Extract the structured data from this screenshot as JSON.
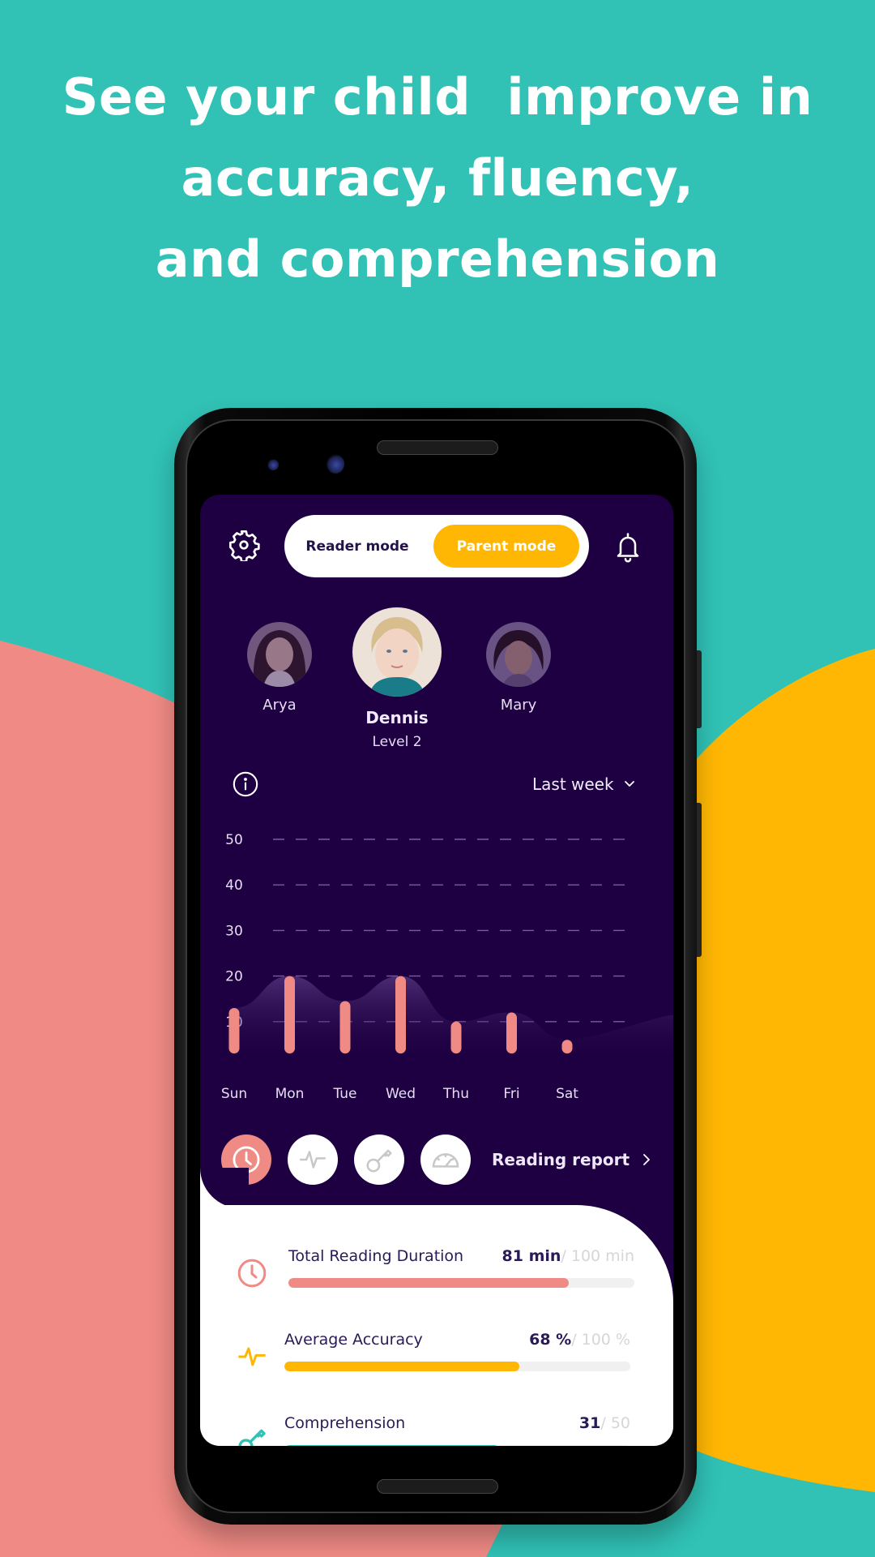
{
  "headline": {
    "lines": [
      "See your child  improve in",
      "accuracy, fluency,",
      "and comprehension"
    ]
  },
  "colors": {
    "teal": "#31C1B5",
    "coral": "#F08A84",
    "yellow": "#FFB703",
    "app_bg": "#1E0042"
  },
  "app": {
    "top_bar": {
      "settings_icon": "gear-icon",
      "modes": [
        {
          "label": "Reader mode",
          "selected": false
        },
        {
          "label": "Parent mode",
          "selected": true
        }
      ],
      "notifications_icon": "bell-icon"
    },
    "profiles": [
      {
        "name": "Arya",
        "selected": false
      },
      {
        "name": "Dennis",
        "level": "Level 2",
        "selected": true
      },
      {
        "name": "Mary",
        "selected": false
      }
    ],
    "info_icon": "info-icon",
    "period": {
      "selected": "Last week",
      "icon": "chevron-down-icon"
    },
    "metric_tabs": [
      {
        "icon": "clock-icon",
        "selected": true
      },
      {
        "icon": "pulse-icon",
        "selected": false
      },
      {
        "icon": "key-icon",
        "selected": false
      },
      {
        "icon": "speedometer-icon",
        "selected": false
      }
    ],
    "report_link": {
      "label": "Reading report",
      "icon": "chevron-right-icon"
    },
    "stats": [
      {
        "label": "Total Reading Duration",
        "value": "81 min",
        "max": "/ 100 min",
        "progress": 0.81,
        "icon": "clock-icon",
        "color": "#F08A84"
      },
      {
        "label": "Average Accuracy",
        "value": "68 %",
        "max": "/ 100 %",
        "progress": 0.68,
        "icon": "pulse-icon",
        "color": "#FFB703"
      },
      {
        "label": "Comprehension",
        "value": "31",
        "max": "/ 50",
        "progress": 0.62,
        "icon": "key-icon",
        "color": "#31C1B5"
      }
    ]
  },
  "chart_data": {
    "type": "bar",
    "title": "",
    "xlabel": "",
    "ylabel": "",
    "categories": [
      "Sun",
      "Mon",
      "Tue",
      "Wed",
      "Thu",
      "Fri",
      "Sat"
    ],
    "values": [
      13,
      20,
      14.5,
      20,
      10,
      12,
      6
    ],
    "baseline": 3,
    "ylim": [
      0,
      50
    ],
    "yticks": [
      10,
      20,
      30,
      40,
      50
    ],
    "grid": true,
    "grid_style": "dashed",
    "area_overlay": true,
    "bar_color": "#F08A84"
  }
}
